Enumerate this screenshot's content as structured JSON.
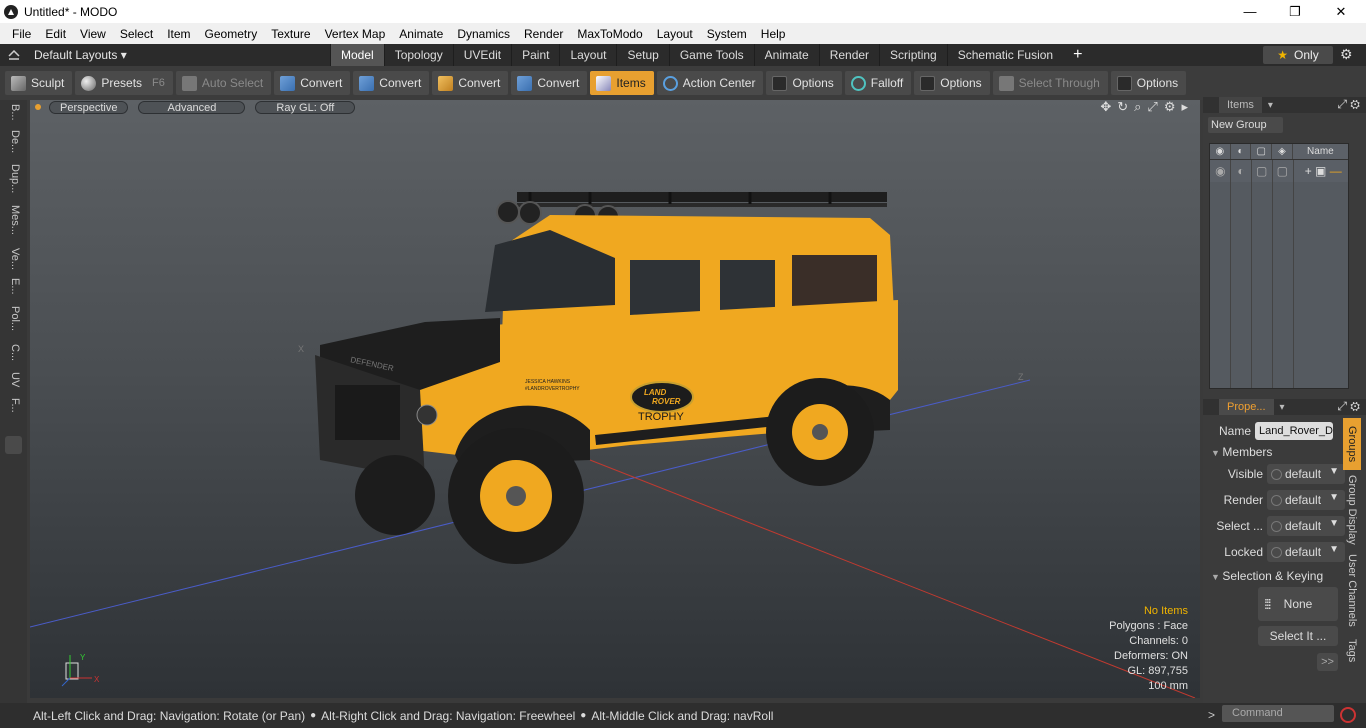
{
  "window": {
    "title": "Untitled* - MODO",
    "minimize": "—",
    "maximize": "❐",
    "close": "✕"
  },
  "menu": [
    "File",
    "Edit",
    "View",
    "Select",
    "Item",
    "Geometry",
    "Texture",
    "Vertex Map",
    "Animate",
    "Dynamics",
    "Render",
    "MaxToModo",
    "Layout",
    "System",
    "Help"
  ],
  "layoutbar": {
    "layout_name": "Default Layouts ▾",
    "tabs": [
      "Model",
      "Topology",
      "UVEdit",
      "Paint",
      "Layout",
      "Setup",
      "Game Tools",
      "Animate",
      "Render",
      "Scripting",
      "Schematic Fusion"
    ],
    "active_tab": "Model",
    "plus": "+",
    "only_label": "Only",
    "only_star": "★"
  },
  "toolbar": {
    "sculpt": "Sculpt",
    "presets": "Presets",
    "presets_key": "F6",
    "auto_select": "Auto Select",
    "convert1": "Convert",
    "convert2": "Convert",
    "convert3": "Convert",
    "convert4": "Convert",
    "items": "Items",
    "action_center": "Action Center",
    "options1": "Options",
    "falloff": "Falloff",
    "options2": "Options",
    "select_through": "Select Through",
    "options3": "Options"
  },
  "left_tabs": [
    "B...",
    "De...",
    "Dup...",
    "Mes...",
    "Ve...",
    "E...",
    "Pol...",
    "C...",
    "UV",
    "F..."
  ],
  "viewport": {
    "perspective": "Perspective",
    "advanced": "Advanced",
    "raygl": "Ray GL: Off",
    "stats": {
      "no_items": "No Items",
      "polygons": "Polygons : Face",
      "channels": "Channels: 0",
      "deformers": "Deformers: ON",
      "gl": "GL: 897,755",
      "scale": "100 mm"
    },
    "car": {
      "hood_text": "DEFENDER",
      "logo_line1": "LAND",
      "logo_line2": "ROVER",
      "trophy": "TROPHY",
      "sticker1": "JESSICA HAWKINS",
      "sticker2": "#LANDROVERTROPHY"
    },
    "axis_x": "X",
    "axis_y": "Y",
    "axis_z": "Z"
  },
  "items_panel": {
    "tab": "Items",
    "new_group": "New Group",
    "name_col": "Name"
  },
  "properties_panel": {
    "tab": "Prope...",
    "name_label": "Name",
    "name_value": "Land_Rover_D",
    "members": "Members",
    "visible_label": "Visible",
    "visible_value": "default",
    "render_label": "Render",
    "render_value": "default",
    "select_label": "Select ...",
    "select_value": "default",
    "locked_label": "Locked",
    "locked_value": "default",
    "selection_keying": "Selection & Keying",
    "none_label": "None",
    "select_it": "Select It ...",
    "more": ">>",
    "side_tabs": [
      "Groups",
      "Group Display",
      "User Channels",
      "Tags"
    ]
  },
  "statusbar": {
    "hint1": "Alt-Left Click and Drag: Navigation: Rotate (or Pan)",
    "hint2": "Alt-Right Click and Drag: Navigation: Freewheel",
    "hint3": "Alt-Middle Click and Drag: navRoll",
    "command_placeholder": "Command"
  },
  "colors": {
    "accent": "#e8a030",
    "car_body": "#f0a820",
    "car_black": "#1e1e1e"
  }
}
